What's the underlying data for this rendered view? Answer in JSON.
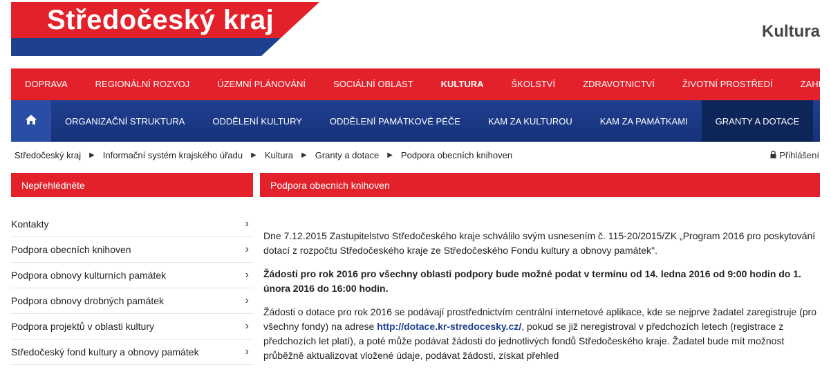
{
  "header": {
    "logo_text": "Středočeský kraj",
    "section_title": "Kultura"
  },
  "topnav": [
    {
      "label": "Doprava",
      "active": false
    },
    {
      "label": "Regionální rozvoj",
      "active": false
    },
    {
      "label": "Územní plánování",
      "active": false
    },
    {
      "label": "Sociální oblast",
      "active": false
    },
    {
      "label": "Kultura",
      "active": true
    },
    {
      "label": "Školství",
      "active": false
    },
    {
      "label": "Zdravotnictví",
      "active": false
    },
    {
      "label": "Životní prostředí",
      "active": false
    },
    {
      "label": "Zahraničí",
      "active": false
    }
  ],
  "subnav": {
    "home_icon": "home-icon",
    "items": [
      {
        "label": "Organizační struktura"
      },
      {
        "label": "Oddělení kultury"
      },
      {
        "label": "Oddělení památkové péče"
      },
      {
        "label": "Kam za kulturou"
      },
      {
        "label": "Kam za památkami"
      },
      {
        "label": "Granty a dotace",
        "active": true
      }
    ]
  },
  "breadcrumb": [
    "Středočeský kraj",
    "Informační systém krajského úřadu",
    "Kultura",
    "Granty a dotace",
    "Podpora obecních knihoven"
  ],
  "login_label": "Přihlášení",
  "sidebar": {
    "title": "Nepřehlédněte",
    "items": [
      "Kontakty",
      "Podpora obecních knihoven",
      "Podpora obnovy kulturních památek",
      "Podpora obnovy drobných památek",
      "Podpora projektů v oblasti kultury",
      "Středočeský fond kultury a obnovy památek"
    ]
  },
  "article": {
    "title": "Podpora obecnich knihoven",
    "p1": "Dne 7.12.2015 Zastupitelstvo Středočeského kraje schválilo svým usnesením č. 115-20/2015/ZK „Program 2016 pro poskytování dotací z rozpočtu Středočeského kraje ze Středočeského Fondu kultury a obnovy památek\".",
    "p2": "Žádosti pro rok 2016 pro všechny oblasti podpory bude možné podat v termínu od 14. ledna 2016 od 9:00 hodin do 1. února 2016 do 16:00 hodin.",
    "p3_before": "Žádosti o dotace pro rok 2016 se podávají prostřednictvím centrální internetové aplikace, kde se nejprve žadatel zaregistruje (pro všechny fondy) na adrese ",
    "p3_link": "http://dotace.kr-stredocesky.cz/",
    "p3_after": ", pokud se již neregistroval v předchozích letech (registrace z předchozích let platí), a poté může podávat žádosti do jednotlivých fondů Středočeského kraje. Žadatel bude mít možnost průběžně aktualizovat vložené údaje, podávat žádosti, získat přehled"
  },
  "colors": {
    "red": "#e3212b",
    "blue": "#1f3f8f",
    "dark_blue": "#0e2559"
  }
}
